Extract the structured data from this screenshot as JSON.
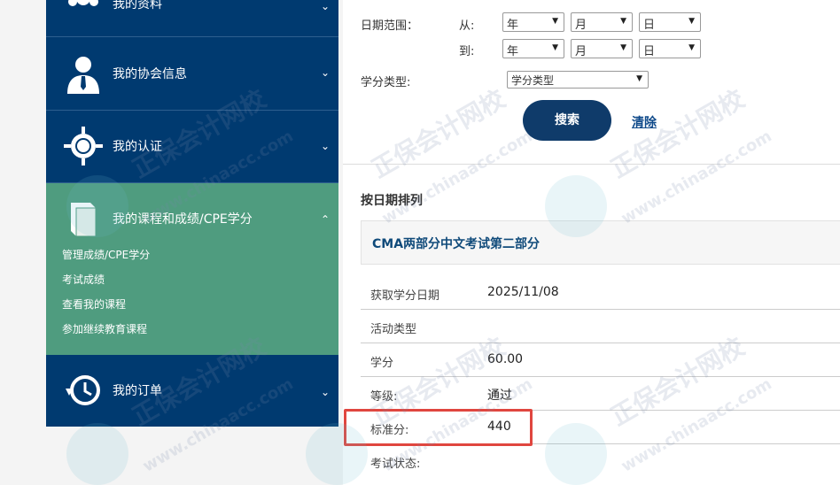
{
  "sidebar": {
    "items": [
      {
        "label": "我的资料"
      },
      {
        "label": "我的协会信息"
      },
      {
        "label": "我的认证"
      },
      {
        "label": "我的课程和成绩/CPE学分"
      },
      {
        "label": "我的订单"
      }
    ],
    "sub_items": [
      "管理成绩/CPE学分",
      "考试成绩",
      "查看我的课程",
      "参加继续教育课程"
    ],
    "chevron_down": "⌄",
    "chevron_up": "⌃"
  },
  "filter": {
    "date_range_label": "日期范围：",
    "from_label": "从:",
    "to_label": "到:",
    "year": "年",
    "month": "月",
    "day": "日",
    "credit_type_label": "学分类型:",
    "credit_type_value": "学分类型",
    "search_label": "搜索",
    "clear_label": "清除"
  },
  "section_title": "按日期排列",
  "course": {
    "title": "CMA两部分中文考试第二部分",
    "rows": [
      {
        "key": "获取学分日期",
        "value": "2025/11/08"
      },
      {
        "key": "活动类型",
        "value": ""
      },
      {
        "key": "学分",
        "value": "60.00"
      },
      {
        "key": "等级:",
        "value": "通过"
      },
      {
        "key": "标准分:",
        "value": "440"
      },
      {
        "key": "考试状态:",
        "value": ""
      }
    ]
  },
  "watermark": {
    "text": "正保会计网校",
    "url": "www.chinaacc.com"
  },
  "colors": {
    "sidebar": "#003a70",
    "active": "#4f9c7f",
    "button": "#0f3b6a",
    "highlight": "#e0463f"
  }
}
